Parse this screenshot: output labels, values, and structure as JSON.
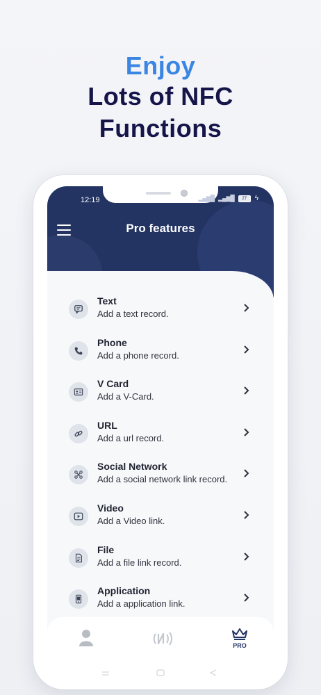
{
  "headline": {
    "line1": "Enjoy",
    "line2": "Lots of NFC",
    "line3": "Functions"
  },
  "status_bar": {
    "time": "12:19",
    "battery": "27"
  },
  "header": {
    "title": "Pro features"
  },
  "items": [
    {
      "title": "Text",
      "subtitle": "Add a text record.",
      "icon": "message-icon"
    },
    {
      "title": "Phone",
      "subtitle": "Add a phone record.",
      "icon": "phone-icon"
    },
    {
      "title": "V Card",
      "subtitle": "Add a V-Card.",
      "icon": "contact-card-icon"
    },
    {
      "title": "URL",
      "subtitle": "Add a url record.",
      "icon": "link-icon"
    },
    {
      "title": "Social Network",
      "subtitle": "Add a social network link record.",
      "icon": "social-network-icon"
    },
    {
      "title": "Video",
      "subtitle": "Add a Video link.",
      "icon": "video-icon"
    },
    {
      "title": "File",
      "subtitle": "Add a file link record.",
      "icon": "file-icon"
    },
    {
      "title": "Application",
      "subtitle": "Add a application link.",
      "icon": "mobile-app-icon"
    }
  ],
  "bottom_nav": {
    "pro_label": "PRO"
  },
  "colors": {
    "header": "#233463",
    "accent": "#3b86e3",
    "headline_dark": "#16154a"
  }
}
